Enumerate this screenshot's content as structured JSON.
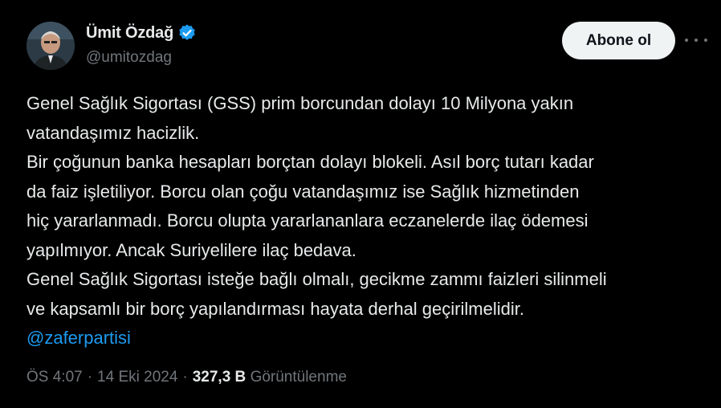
{
  "author": {
    "display_name": "Ümit Özdağ",
    "handle": "@umitozdag",
    "verified": true,
    "avatar_icon": "profile-photo"
  },
  "actions": {
    "follow_label": "Abone ol",
    "more_icon": "more-horizontal-icon"
  },
  "tweet": {
    "lines": [
      "Genel Sağlık Sigortası (GSS) prim borcundan dolayı 10 Milyona yakın",
      "vatandaşımız hacizlik.",
      "Bir çoğunun banka hesapları borçtan dolayı blokeli. Asıl borç tutarı kadar",
      "da faiz işletiliyor. Borcu olan çoğu vatandaşımız ise Sağlık hizmetinden",
      "hiç yararlanmadı. Borcu olupta yararlananlara eczanelerde ilaç ödemesi",
      "yapılmıyor. Ancak Suriyelilere ilaç bedava.",
      "Genel Sağlık Sigortası isteğe bağlı olmalı, gecikme zammı faizleri silinmeli",
      "ve kapsamlı bir borç yapılandırması hayata derhal geçirilmelidir."
    ],
    "mention": "@zaferpartisi"
  },
  "meta": {
    "time": "ÖS 4:07",
    "separator": "·",
    "date": "14 Eki 2024",
    "views_count": "327,3 B",
    "views_label": "Görüntülenme"
  },
  "colors": {
    "background": "#000000",
    "text": "#e7e9ea",
    "secondary": "#71767b",
    "accent": "#1d9bf0",
    "button_bg": "#eff3f4"
  }
}
